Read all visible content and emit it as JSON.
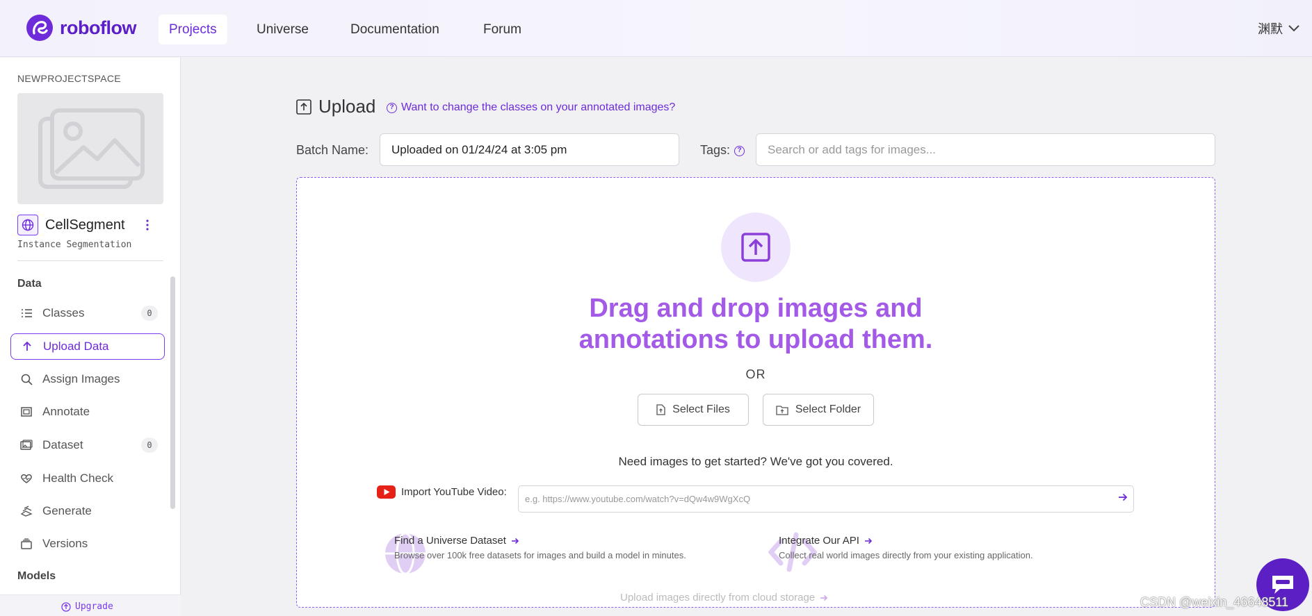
{
  "brand": {
    "name": "roboflow",
    "accent": "#6d2bd9"
  },
  "nav": {
    "items": [
      "Projects",
      "Universe",
      "Documentation",
      "Forum"
    ],
    "active": "Projects",
    "user": "渊默"
  },
  "sidebar": {
    "workspace": "NEWPROJECTSPACE",
    "project_name": "CellSegment",
    "project_type": "Instance Segmentation",
    "sections": {
      "data": "Data",
      "models": "Models"
    },
    "items": [
      {
        "label": "Classes",
        "icon": "list-icon",
        "count": "0"
      },
      {
        "label": "Upload Data",
        "icon": "arrow-up-icon",
        "active": true
      },
      {
        "label": "Assign Images",
        "icon": "search-icon"
      },
      {
        "label": "Annotate",
        "icon": "annotate-icon"
      },
      {
        "label": "Dataset",
        "icon": "images-icon",
        "count": "0"
      },
      {
        "label": "Health Check",
        "icon": "heart-icon"
      },
      {
        "label": "Generate",
        "icon": "generate-icon"
      },
      {
        "label": "Versions",
        "icon": "versions-icon"
      }
    ],
    "upgrade": "Upgrade"
  },
  "upload": {
    "title": "Upload",
    "help_link": "Want to change the classes on your annotated images?",
    "batch_label": "Batch Name:",
    "batch_value": "Uploaded on 01/24/24 at 3:05 pm",
    "tags_label": "Tags:",
    "tags_placeholder": "Search or add tags for images...",
    "drag_line1": "Drag and drop images and",
    "drag_line2": "annotations to upload them.",
    "or": "OR",
    "select_files": "Select Files",
    "select_folder": "Select Folder",
    "need_images": "Need images to get started? We've got you covered.",
    "youtube_label": "Import YouTube Video:",
    "youtube_placeholder": "e.g. https://www.youtube.com/watch?v=dQw4w9WgXcQ",
    "universe_title": "Find a Universe Dataset",
    "universe_desc": "Browse over 100k free datasets for images and build a model in minutes.",
    "api_title": "Integrate Our API",
    "api_desc": "Collect real world images directly from your existing application.",
    "cloud": "Upload images directly from cloud storage"
  },
  "watermark": "CSDN @weixin_46648511"
}
